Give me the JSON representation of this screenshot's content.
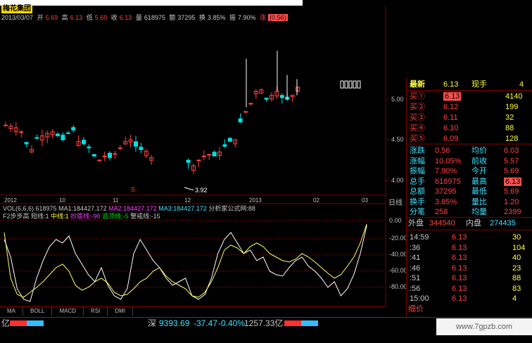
{
  "window": {
    "title": "梅花集团"
  },
  "info_bar": {
    "date": "2013/03/07",
    "open_label": "开",
    "open": "5.69",
    "high_label": "高",
    "high": "6.13",
    "low_label": "低",
    "low": "5.69",
    "close_label": "收",
    "close": "6.13",
    "volume_label": "量",
    "volume": "618975",
    "amount_label": "额",
    "amount": "37295",
    "turnover_label": "换",
    "turnover": "3.85%",
    "amplitude_label": "振",
    "amplitude": "7.90%",
    "change_label": "涨",
    "change": "(0.56)"
  },
  "price_axis": {
    "ticks": [
      "5.00",
      "4.50",
      "4.00"
    ]
  },
  "min_price_note": "3.92",
  "date_axis": {
    "labels": [
      "2012",
      "10",
      "11",
      "12",
      "2013",
      "02",
      "03"
    ],
    "scale_label": "日线"
  },
  "volume_title": {
    "text": "VOL(6,6,6) 618975",
    "ma1": "MA1:184427.172",
    "ma2": "MA2:184427.172",
    "ma3": "MA3:184427.172",
    "source": "分析家公式网:88"
  },
  "f2_title": {
    "name": "F2步步高",
    "short": "短线:1",
    "mid": "中线:1",
    "bottom": "抄底线:-90",
    "escape": "逃顶线:-5",
    "warn": "警戒线:-15"
  },
  "osc_axis": {
    "ticks": [
      "0.00",
      "-20.00",
      "-40.00",
      "-60.00",
      "-80.00"
    ]
  },
  "tabs": [
    "MA",
    "BOLL",
    "MACD",
    "RSI",
    "DMI"
  ],
  "quote": {
    "latest_label": "最新",
    "latest": "6.13",
    "hand_label": "现手",
    "hand": "4",
    "buys": [
      {
        "label": "买①",
        "price": "6.13",
        "qty": "4140"
      },
      {
        "label": "买②",
        "price": "6.12",
        "qty": "199"
      },
      {
        "label": "买③",
        "price": "6.11",
        "qty": "32"
      },
      {
        "label": "买④",
        "price": "6.10",
        "qty": "88"
      },
      {
        "label": "买⑤",
        "price": "6.09",
        "qty": "128"
      }
    ],
    "stats": [
      {
        "l1": "涨跌",
        "v1": "0.56",
        "l2": "均价",
        "v2": "6.03"
      },
      {
        "l1": "涨幅",
        "v1": "10.05%",
        "l2": "前收",
        "v2": "5.57"
      },
      {
        "l1": "振幅",
        "v1": "7.90%",
        "l2": "今开",
        "v2": "5.69"
      },
      {
        "l1": "总手",
        "v1": "618975",
        "l2": "最高",
        "v2": "6.13"
      },
      {
        "l1": "总额",
        "v1": "37295",
        "l2": "最低",
        "v2": "5.69"
      },
      {
        "l1": "换手",
        "v1": "3.85%",
        "l2": "量比",
        "v2": "1.20"
      },
      {
        "l1": "分笔",
        "v1": "258",
        "l2": "均量",
        "v2": "2399"
      }
    ],
    "outer_label": "外盘",
    "outer": "344540",
    "inner_label": "内盘",
    "inner": "274435",
    "ticks": [
      {
        "t": "14:59",
        "p": "6.13",
        "v": "30"
      },
      {
        "t": ":36",
        "p": "6.13",
        "v": "104"
      },
      {
        "t": ":41",
        "p": "6.13",
        "v": "40"
      },
      {
        "t": ":46",
        "p": "6.13",
        "v": "23"
      },
      {
        "t": ":51",
        "p": "6.13",
        "v": "88"
      },
      {
        "t": ":56",
        "p": "6.13",
        "v": "83"
      },
      {
        "t": "15:00",
        "p": "6.13",
        "v": "4"
      }
    ],
    "footer": "细价"
  },
  "status_bar": {
    "left_unit": "亿",
    "index_name": "深",
    "index_value": "9393.69",
    "index_change": "-37.47",
    "index_pct": "-0.40%",
    "index_amount": "1257.33亿"
  },
  "watermark": "www.7gpzb.com",
  "colors": {
    "up": "#ff4040",
    "down": "#00e0e0",
    "ma": "#ffffff",
    "osc1": "#ffffff",
    "osc2": "#ffff60"
  }
}
